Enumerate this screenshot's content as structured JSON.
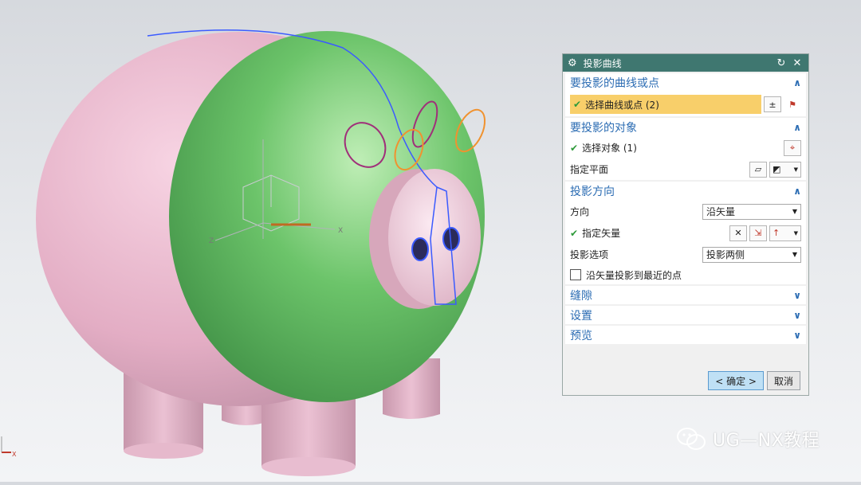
{
  "dialog": {
    "title": "投影曲线",
    "sections": {
      "curves": {
        "header": "要投影的曲线或点",
        "select_label": "选择曲线或点 (2)"
      },
      "objects": {
        "header": "要投影的对象",
        "select_label": "选择对象 (1)",
        "plane_label": "指定平面"
      },
      "direction": {
        "header": "投影方向",
        "direction_label": "方向",
        "direction_value": "沿矢量",
        "vector_label": "指定矢量",
        "option_label": "投影选项",
        "option_value": "投影两侧",
        "checkbox_label": "沿矢量投影到最近的点"
      },
      "gap": {
        "header": "缝隙"
      },
      "settings": {
        "header": "设置"
      },
      "preview": {
        "header": "预览"
      }
    },
    "ok_label": "< 确定 >",
    "cancel_label": "取消"
  },
  "axis_labels": {
    "z": "Z",
    "x": "X",
    "corner_x": "X"
  },
  "watermark": "UG—NX教程",
  "colors": {
    "titlebar": "#3f7770",
    "section_header": "#2b6cb3",
    "selection_highlight": "#f8cf6a",
    "model_green": "#6cc46a",
    "model_pink": "#e7b6cb"
  }
}
